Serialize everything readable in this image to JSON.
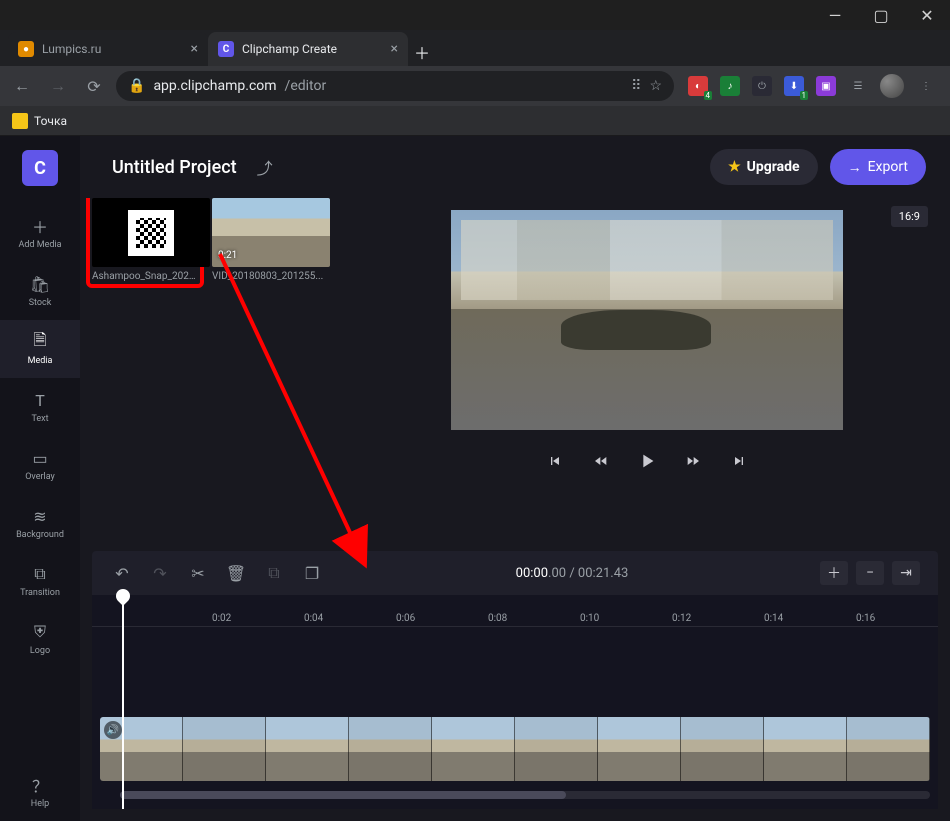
{
  "browser": {
    "tabs": [
      {
        "title": "Lumpics.ru",
        "active": false
      },
      {
        "title": "Clipchamp Create",
        "active": true
      }
    ],
    "url_display_secure": "app.clipchamp.com",
    "url_display_path": "/editor",
    "bookmark": "Точка"
  },
  "topbar": {
    "project_title": "Untitled Project",
    "upgrade_label": "Upgrade",
    "export_label": "Export",
    "aspect_label": "16:9"
  },
  "rail": {
    "add_media": "Add Media",
    "stock": "Stock",
    "media": "Media",
    "text": "Text",
    "overlay": "Overlay",
    "background": "Background",
    "transition": "Transition",
    "logo": "Logo",
    "help": "Help"
  },
  "media": {
    "item1_name": "Ashampoo_Snap_2020...",
    "item2_name": "VID_20180803_201255...",
    "item2_duration": "0:21"
  },
  "timeline": {
    "current": "00:00",
    "current_ms": ".00",
    "total": "00:21",
    "total_ms": ".43",
    "ticks": [
      "0:02",
      "0:04",
      "0:06",
      "0:08",
      "0:10",
      "0:12",
      "0:14",
      "0:16"
    ]
  }
}
